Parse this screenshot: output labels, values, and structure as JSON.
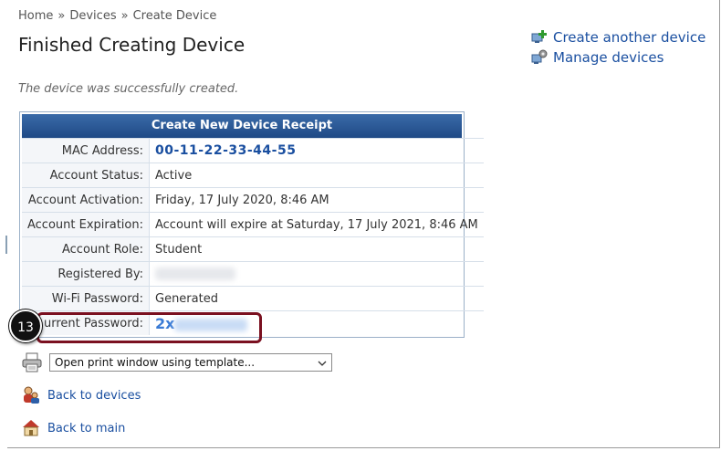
{
  "breadcrumb": {
    "home": "Home",
    "sep1": "»",
    "devices": "Devices",
    "sep2": "»",
    "current": "Create Device"
  },
  "page_title": "Finished Creating Device",
  "success_message": "The device was successfully created.",
  "actions": {
    "create_another": "Create another device",
    "manage": "Manage devices"
  },
  "receipt": {
    "title": "Create New Device Receipt",
    "rows": [
      {
        "label": "MAC Address:",
        "value": "00-11-22-33-44-55"
      },
      {
        "label": "Account Status:",
        "value": "Active"
      },
      {
        "label": "Account Activation:",
        "value": "Friday, 17 July 2020, 8:46 AM"
      },
      {
        "label": "Account Expiration:",
        "value": "Account will expire at Saturday, 17 July 2021, 8:46 AM"
      },
      {
        "label": "Account Role:",
        "value": "Student"
      },
      {
        "label": "Registered By:",
        "value": ""
      },
      {
        "label": "Wi-Fi Password:",
        "value": "Generated"
      },
      {
        "label": "urrent Password:",
        "value": "2x"
      }
    ]
  },
  "callout_number": "13",
  "print": {
    "selected": "Open print window using template..."
  },
  "links": {
    "back_devices": "Back to devices",
    "back_main": "Back to main"
  },
  "colors": {
    "link": "#1a4fa0",
    "header": "#1f4a86",
    "highlight": "#7a1020"
  }
}
